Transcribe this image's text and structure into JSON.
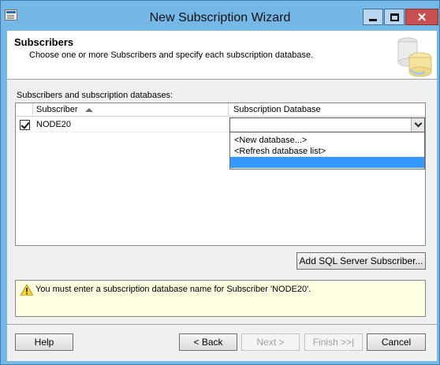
{
  "window": {
    "title": "New Subscription Wizard"
  },
  "header": {
    "title": "Subscribers",
    "description": "Choose one or more Subscribers and specify each subscription database."
  },
  "grid": {
    "label": "Subscribers and subscription databases:",
    "columns": {
      "subscriber": "Subscriber",
      "database": "Subscription Database"
    },
    "rows": [
      {
        "checked": true,
        "subscriber": "NODE20",
        "database": ""
      }
    ]
  },
  "dropdown": {
    "options": [
      "<New database...>",
      "<Refresh database list>",
      ""
    ],
    "selected_index": 2
  },
  "add_button": "Add SQL Server Subscriber...",
  "message": "You must enter a subscription database name for Subscriber 'NODE20'.",
  "footer": {
    "help": "Help",
    "back": "< Back",
    "next": "Next >",
    "finish": "Finish >>|",
    "cancel": "Cancel"
  },
  "colors": {
    "titlebar": "#75b7e7",
    "selection": "#3399ff",
    "message_bg": "#ffffe1",
    "close_button": "#c75050"
  }
}
